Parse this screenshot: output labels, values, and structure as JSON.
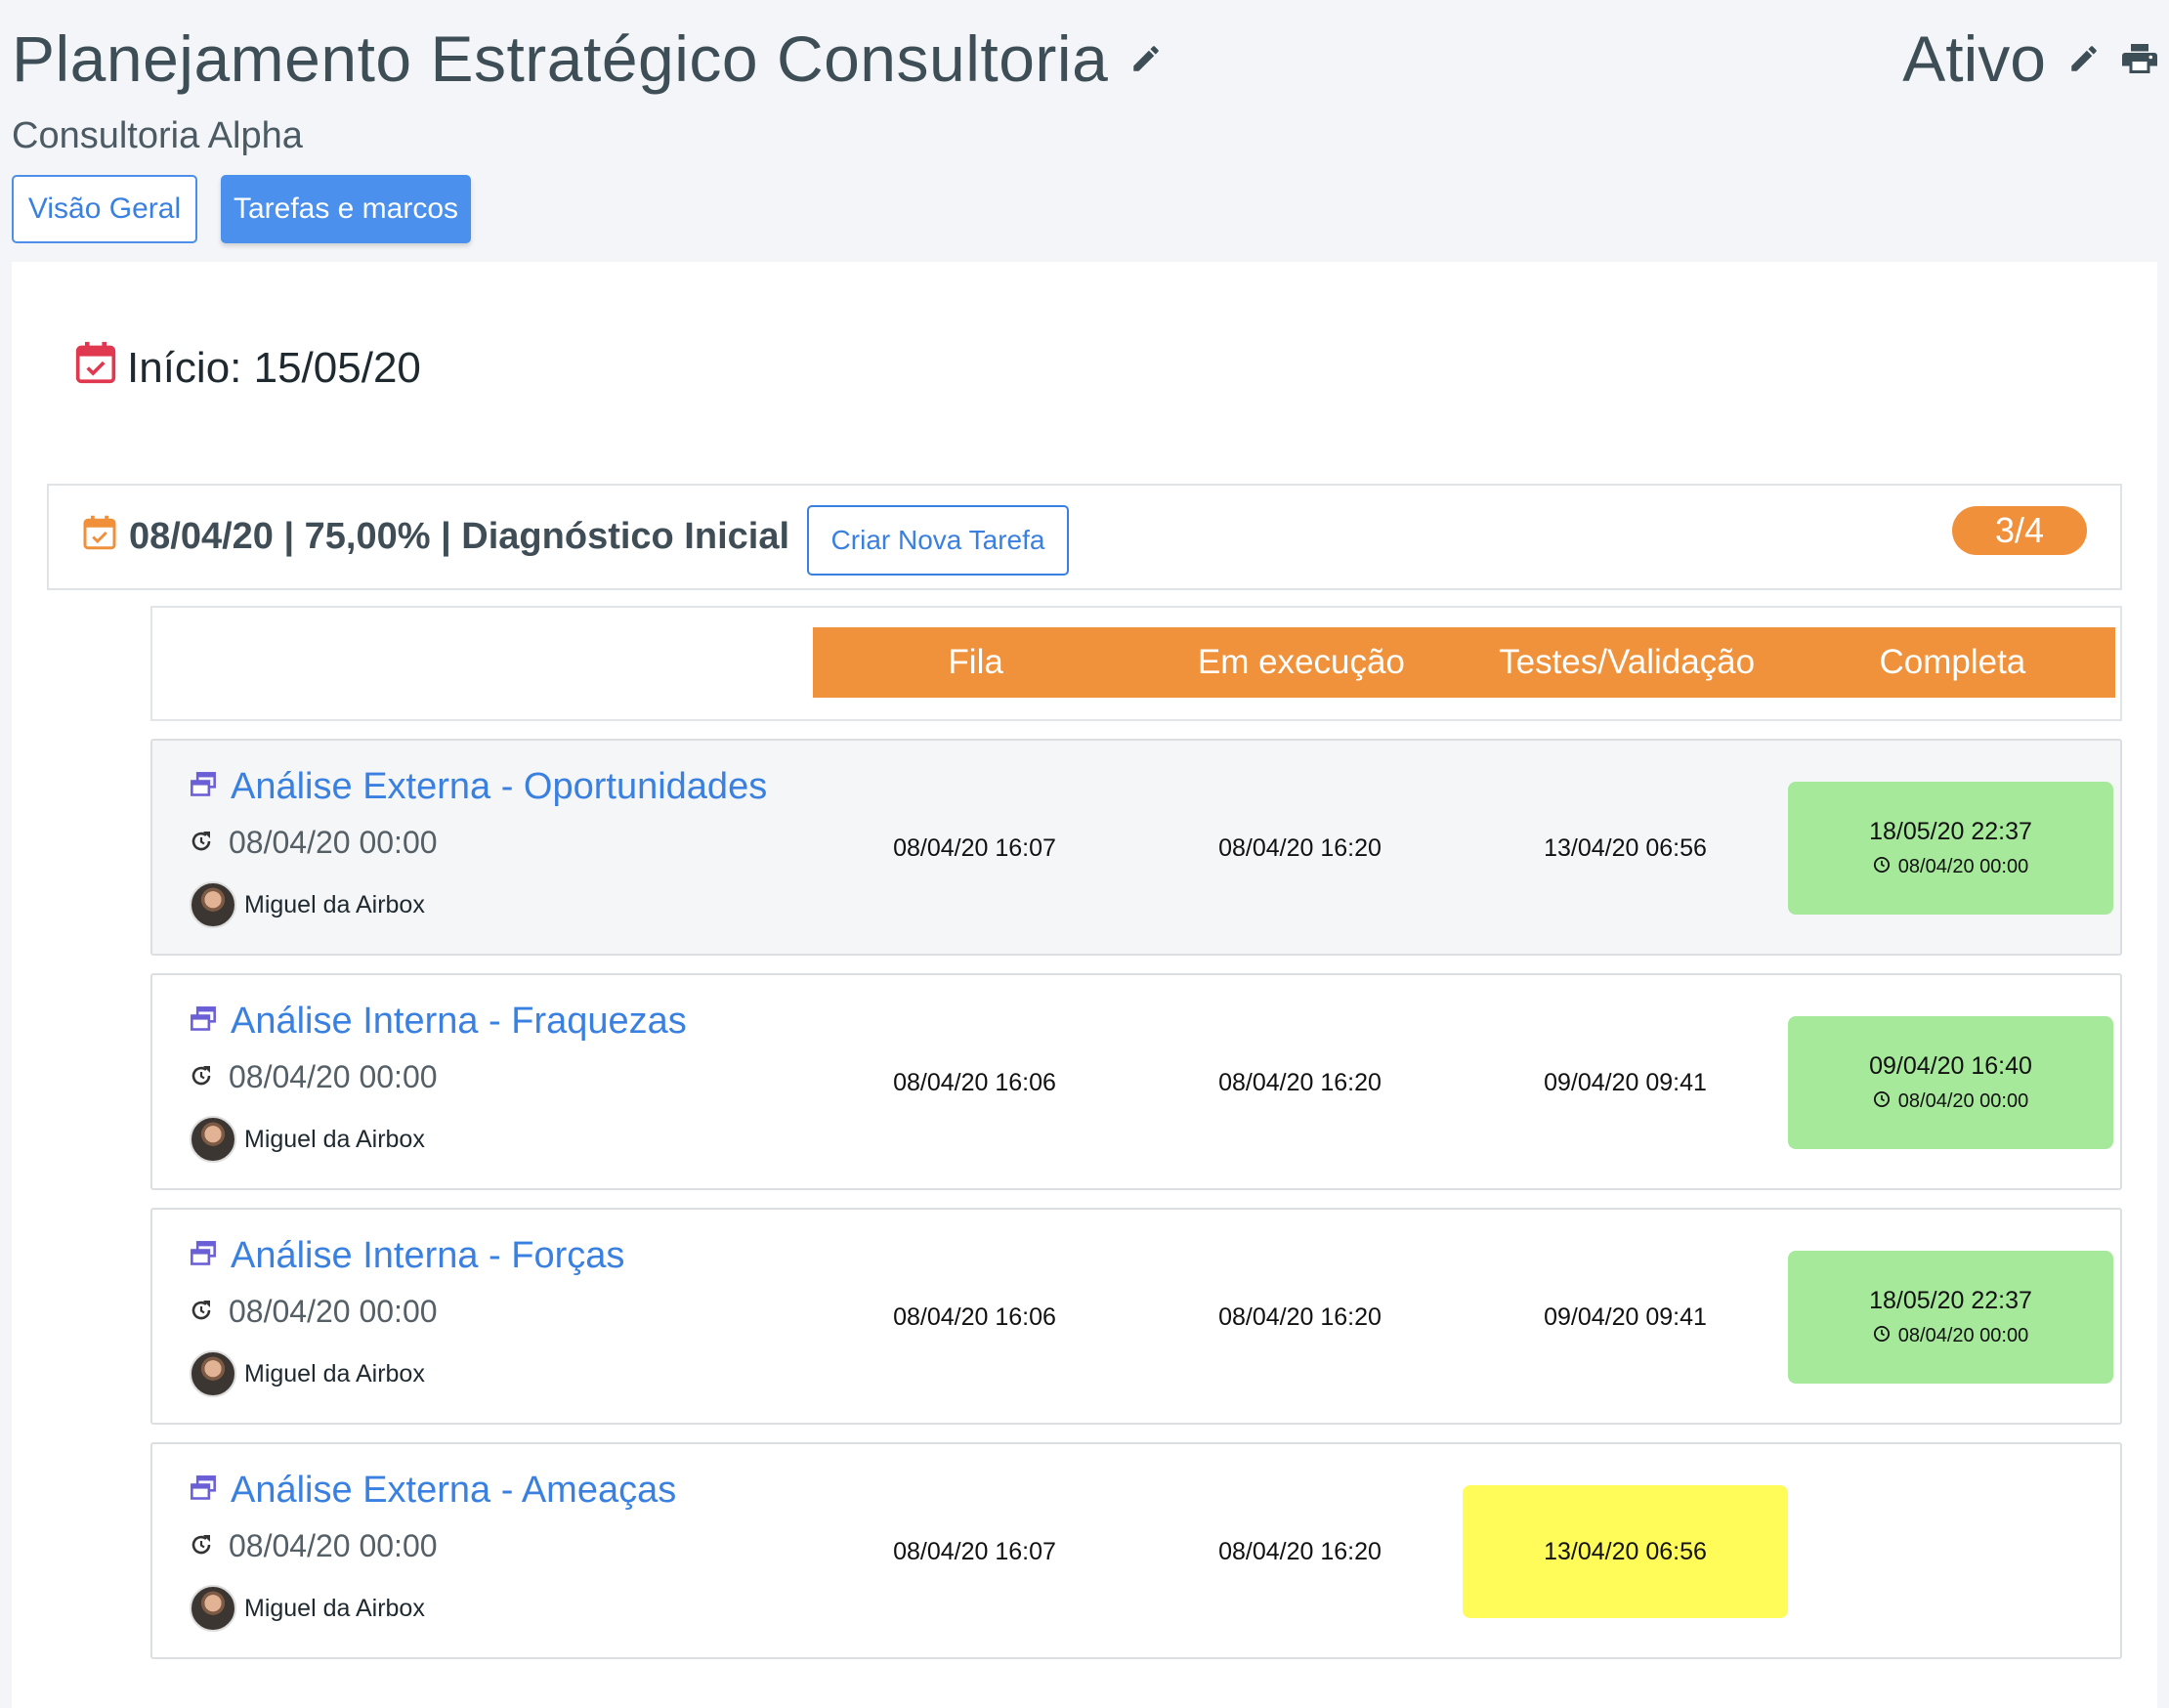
{
  "project": {
    "title": "Planejamento Estratégico Consultoria",
    "status": "Ativo",
    "client": "Consultoria Alpha"
  },
  "tabs": [
    {
      "label": "Visão Geral"
    },
    {
      "label": "Tarefas e marcos"
    }
  ],
  "start": {
    "label": "Início: 15/05/20"
  },
  "milestone": {
    "summary": "08/04/20 | 75,00% | Diagnóstico Inicial",
    "new_task_label": "Criar Nova Tarefa",
    "count": "3/4"
  },
  "stages": [
    "Fila",
    "Em execução",
    "Testes/Validação",
    "Completa"
  ],
  "tasks": [
    {
      "name": "Análise Externa - Oportunidades",
      "date": "08/04/20 00:00",
      "user": "Miguel da Airbox",
      "fila": "08/04/20 16:07",
      "execucao": "08/04/20 16:20",
      "testes": "13/04/20 06:56",
      "completa": "18/05/20 22:37",
      "completa_sub": "08/04/20 00:00"
    },
    {
      "name": "Análise Interna - Fraquezas",
      "date": "08/04/20 00:00",
      "user": "Miguel da Airbox",
      "fila": "08/04/20 16:06",
      "execucao": "08/04/20 16:20",
      "testes": "09/04/20 09:41",
      "completa": "09/04/20 16:40",
      "completa_sub": "08/04/20 00:00"
    },
    {
      "name": "Análise Interna - Forças",
      "date": "08/04/20 00:00",
      "user": "Miguel da Airbox",
      "fila": "08/04/20 16:06",
      "execucao": "08/04/20 16:20",
      "testes": "09/04/20 09:41",
      "completa": "18/05/20 22:37",
      "completa_sub": "08/04/20 00:00"
    },
    {
      "name": "Análise Externa - Ameaças",
      "date": "08/04/20 00:00",
      "user": "Miguel da Airbox",
      "fila": "08/04/20 16:07",
      "execucao": "08/04/20 16:20",
      "testes": "13/04/20 06:56"
    }
  ],
  "colors": {
    "accent": "#4a90ec",
    "stage_header": "#f0913b",
    "badge": "#f0903a",
    "completed": "#a6e99b",
    "current": "#fffb58",
    "start_icon": "#e0394f",
    "milestone_icon": "#f0903a",
    "task_icon": "#6b5fd6"
  },
  "icons": {
    "edit": "pencil-icon",
    "print": "printer-icon",
    "start": "calendar-check-icon",
    "milestone": "calendar-check-icon",
    "task": "windows-icon",
    "date": "refresh-clock-icon",
    "sub": "clock-icon"
  }
}
